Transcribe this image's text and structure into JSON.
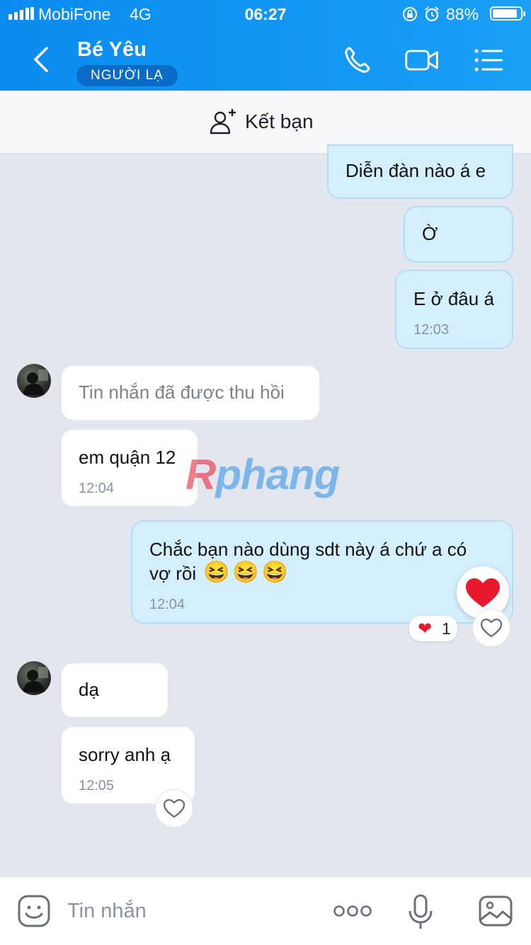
{
  "status": {
    "carrier": "MobiFone",
    "network": "4G",
    "time": "06:27",
    "battery": "88%",
    "battery_level": 0.88
  },
  "header": {
    "contact_name": "Bé Yêu",
    "badge": "NGƯỜI LẠ",
    "icons": [
      "back-arrow-icon",
      "phone-icon",
      "video-call-icon",
      "menu-icon"
    ]
  },
  "friend_bar": {
    "label": "Kết bạn",
    "icon": "add-friend-icon"
  },
  "messages": [
    {
      "from": "me",
      "text": "Diễn đàn nào á e"
    },
    {
      "from": "me",
      "text": "Ờ"
    },
    {
      "from": "me",
      "text": "E ở đâu á",
      "time": "12:03"
    },
    {
      "from": "them",
      "text": "Tin nhắn đã được thu hồi",
      "recalled": true
    },
    {
      "from": "them",
      "text": "em quận 12",
      "time": "12:04"
    },
    {
      "from": "me",
      "text_line1": "Chắc bạn nào dùng sdt này á chứ a có",
      "text_line2": "vợ rồi",
      "emoji": "😆😆😆",
      "time": "12:04",
      "reaction_emoji": "❤",
      "reaction_count": "1"
    },
    {
      "from": "them",
      "text": "dạ"
    },
    {
      "from": "them",
      "text": "sorry anh ạ",
      "time": "12:05"
    }
  ],
  "watermark": {
    "part1": "R",
    "part2": "phang"
  },
  "composer": {
    "placeholder": "Tin nhắn",
    "icons": [
      "sticker-icon",
      "more-icon",
      "microphone-icon",
      "image-icon"
    ]
  },
  "colors": {
    "header": "#1a9cf5",
    "outgoing_bubble": "#d4effd",
    "incoming_bubble": "#ffffff",
    "background": "#e2e6ef",
    "heart": "#e8192c"
  }
}
